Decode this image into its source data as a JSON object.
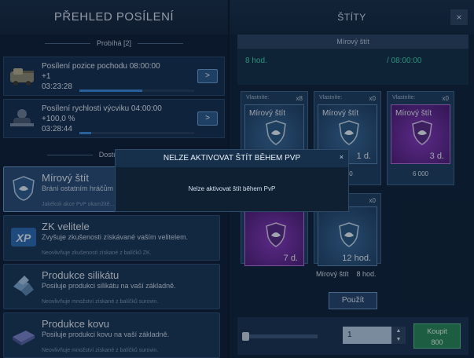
{
  "left": {
    "title": "PŘEHLED POSÍLENÍ",
    "in_progress_label": "Probíhá [2]",
    "available_label": "Dostupné",
    "boosts": [
      {
        "title": "Posílení pozice pochodu 08:00:00",
        "line2": "+1",
        "time": "03:23:28",
        "progress": 0.55,
        "go": ">"
      },
      {
        "title": "Posílení rychlosti výcviku 04:00:00",
        "line2": "+100,0 %",
        "time": "03:28:44",
        "progress": 0.1,
        "go": ">"
      }
    ],
    "items": [
      {
        "name": "Mírový štít",
        "desc": "Brání ostatním hráčům ... vaší základny.",
        "note": "Jakékoli akce PvP okamžitě..."
      },
      {
        "name": "ZK velitele",
        "desc": "Zvyšuje zkušenosti získávané vaším velitelem.",
        "note": "Neovlivňuje zkušenosti získané z balíčků ZK."
      },
      {
        "name": "Produkce silikátu",
        "desc": "Posiluje produkci silikátu na vaší základně.",
        "note": "Neovlivňuje množství získané z balíčků surovin."
      },
      {
        "name": "Produkce kovu",
        "desc": "Posiluje produkci kovu na vaší základně.",
        "note": "Neovlivňuje množství získané z balíčků surovin."
      }
    ]
  },
  "right": {
    "title": "ŠTÍTY",
    "close": "×",
    "strip": "Mírový štít",
    "duration": "8 hod.",
    "timer": "/ 08:00:00",
    "cards": [
      {
        "owner": "Vlastníte:",
        "count": "x8",
        "name": "Mírový štít",
        "dur": "",
        "price": "",
        "purple": false
      },
      {
        "owner": "Vlastníte:",
        "count": "x0",
        "name": "Mírový štít",
        "dur": "1 d.",
        "price": "500",
        "purple": false
      },
      {
        "owner": "Vlastníte:",
        "count": "x0",
        "name": "Mírový štít",
        "dur": "3 d.",
        "price": "6 000",
        "purple": true
      },
      {
        "owner": "",
        "count": "",
        "name": "",
        "dur": "7 d.",
        "price": "",
        "purple": true
      },
      {
        "owner": "",
        "count": "x0",
        "name": "",
        "dur": "12 hod.",
        "price": "",
        "purple": false
      }
    ],
    "selected_name": "Mírový štít",
    "selected_duration": "8 hod.",
    "use_label": "Použít",
    "quantity": "1",
    "step_up": "▲",
    "step_down": "▼",
    "buy_label": "Koupit",
    "buy_price": "800"
  },
  "modal": {
    "title": "NELZE AKTIVOVAT ŠTÍT BĚHEM PVP",
    "close": "×",
    "message": "Nelze aktivovat štít během PvP"
  }
}
